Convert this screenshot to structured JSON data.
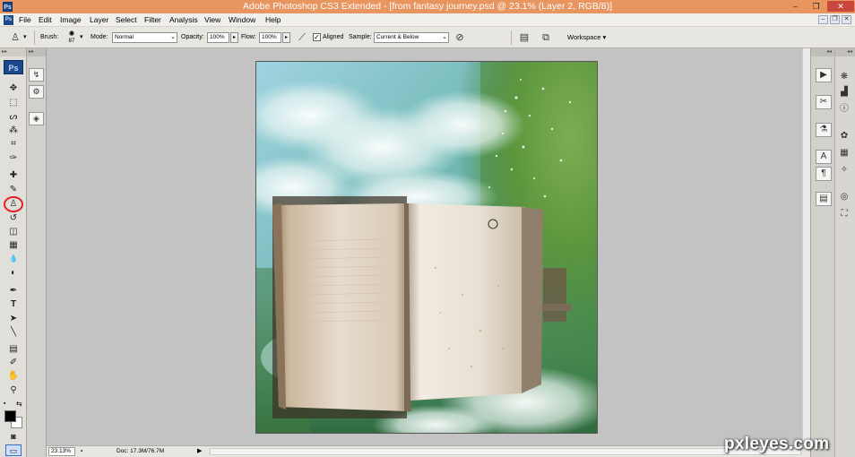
{
  "app": {
    "title": "Adobe Photoshop CS3 Extended - [from fantasy journey.psd @ 23.1% (Layer 2, RGB/8)]",
    "logo": "Ps",
    "window_controls": [
      "–",
      "❐",
      "✕"
    ]
  },
  "menu": {
    "items": [
      "File",
      "Edit",
      "Image",
      "Layer",
      "Select",
      "Filter",
      "Analysis",
      "View",
      "Window",
      "Help"
    ],
    "doc_controls": [
      "–",
      "❐",
      "✕"
    ]
  },
  "options": {
    "brush_label": "Brush:",
    "brush_size": "87",
    "mode_label": "Mode:",
    "mode_value": "Normal",
    "opacity_label": "Opacity:",
    "opacity_value": "100%",
    "flow_label": "Flow:",
    "flow_value": "100%",
    "aligned_label": "Aligned",
    "aligned_checked": true,
    "sample_label": "Sample:",
    "sample_value": "Current & Below",
    "workspace_label": "Workspace ▾"
  },
  "toolbox": {
    "badge": "Ps",
    "active_tool": "clone-stamp-tool",
    "tools": [
      {
        "name": "move-tool-icon",
        "glyph": "✥"
      },
      {
        "name": "marquee-tool-icon",
        "glyph": "⬚"
      },
      {
        "name": "lasso-tool-icon",
        "glyph": "ᔕ"
      },
      {
        "name": "magic-wand-tool-icon",
        "glyph": "⁂"
      },
      {
        "name": "crop-tool-icon",
        "glyph": "⌗"
      },
      {
        "name": "slice-tool-icon",
        "glyph": "✑"
      },
      {
        "name": "healing-brush-tool-icon",
        "glyph": "✚"
      },
      {
        "name": "brush-tool-icon",
        "glyph": "✎"
      },
      {
        "name": "clone-stamp-tool-icon",
        "glyph": "♙"
      },
      {
        "name": "history-brush-tool-icon",
        "glyph": "↺"
      },
      {
        "name": "eraser-tool-icon",
        "glyph": "◫"
      },
      {
        "name": "gradient-tool-icon",
        "glyph": "▦"
      },
      {
        "name": "blur-tool-icon",
        "glyph": "💧"
      },
      {
        "name": "dodge-tool-icon",
        "glyph": "◐"
      },
      {
        "name": "pen-tool-icon",
        "glyph": "✒"
      },
      {
        "name": "type-tool-icon",
        "glyph": "T"
      },
      {
        "name": "path-selection-tool-icon",
        "glyph": "➤"
      },
      {
        "name": "line-tool-icon",
        "glyph": "╲"
      },
      {
        "name": "notes-tool-icon",
        "glyph": "▤"
      },
      {
        "name": "eyedropper-tool-icon",
        "glyph": "✐"
      },
      {
        "name": "hand-tool-icon",
        "glyph": "✋"
      },
      {
        "name": "zoom-tool-icon",
        "glyph": "⚲"
      }
    ]
  },
  "status": {
    "zoom": "23.13%",
    "doc_info": "Doc: 17.3M/76.7M"
  },
  "watermark": "pxleyes.com"
}
